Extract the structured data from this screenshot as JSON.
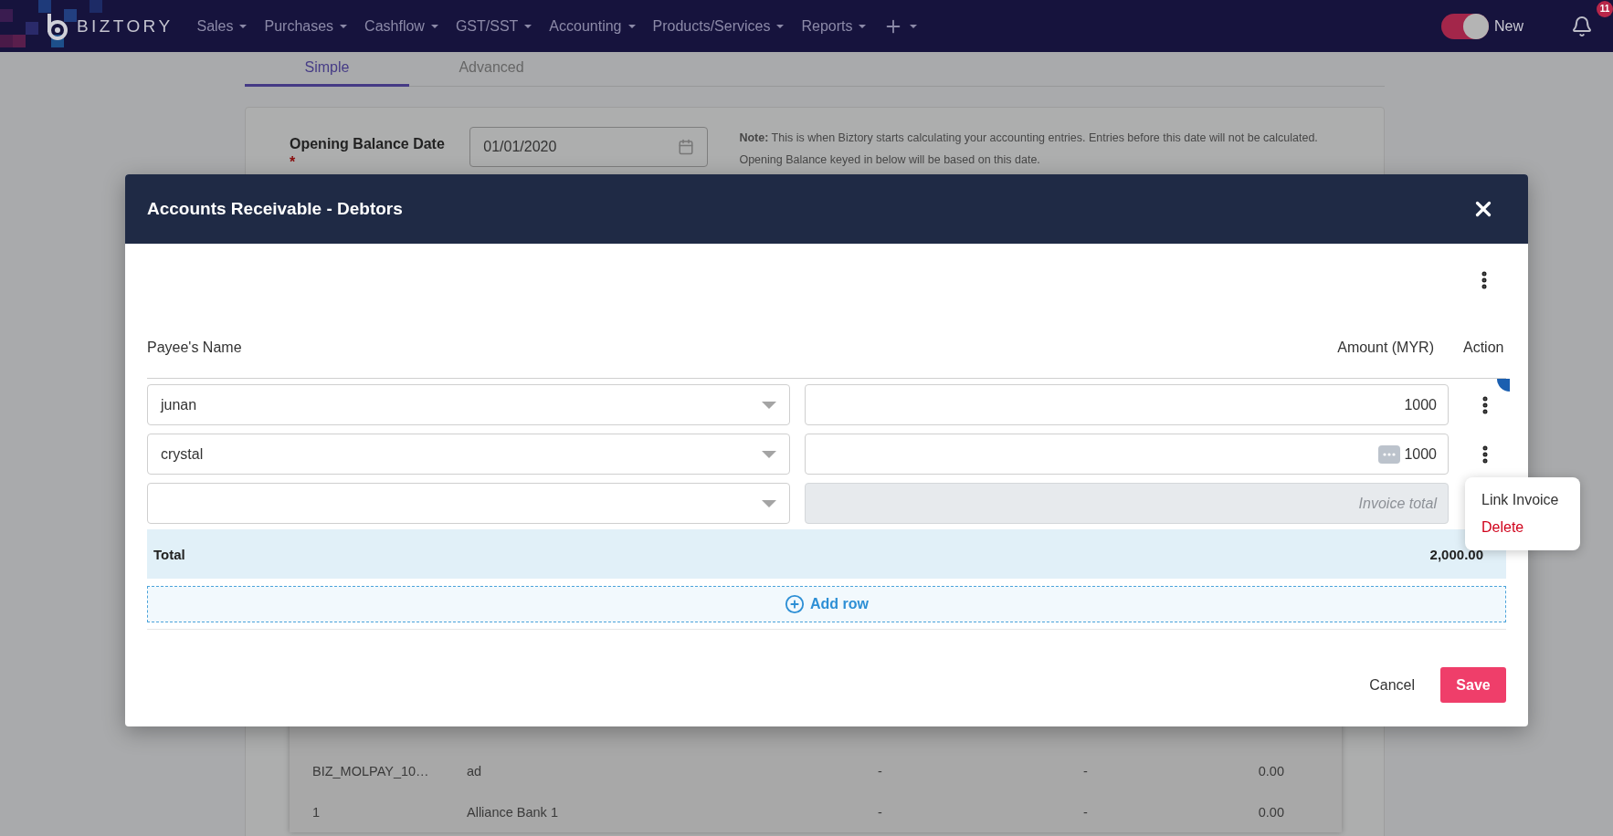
{
  "navbar": {
    "brand": "BIZTORY",
    "menu": [
      "Sales",
      "Purchases",
      "Cashflow",
      "GST/SST",
      "Accounting",
      "Products/Services",
      "Reports"
    ],
    "toggle": {
      "label": "New",
      "on": true
    },
    "notifications": {
      "count": "11"
    }
  },
  "tabs": [
    {
      "label": "Simple",
      "selected": true
    },
    {
      "label": "Advanced",
      "selected": false
    }
  ],
  "opening_balance": {
    "label": "Opening Balance Date",
    "required_mark": "*",
    "value": "01/01/2020",
    "note": "**Note:** This is when Biztory starts calculating your accounting entries. Entries before this date will not be calculated. Opening Balance keyed in below will be based on this date."
  },
  "background_table": {
    "rows": [
      [
        "BIZ_MOLPAY_10…",
        "ad",
        "-",
        "-",
        "0.00"
      ],
      [
        "1",
        "Alliance Bank 1",
        "-",
        "-",
        "0.00"
      ]
    ]
  },
  "dialog": {
    "title": "Accounts Receivable - Debtors",
    "columns": [
      "Payee's Name",
      "Amount (MYR)",
      "Action"
    ],
    "rows": [
      {
        "payee": "junan",
        "amount": "1000",
        "menu_open": false,
        "chip": false,
        "disabled": false
      },
      {
        "payee": "crystal",
        "amount": "1000",
        "menu_open": true,
        "chip": true,
        "disabled": false
      },
      {
        "amount_placeholder": "Invoice total",
        "menu_open": false,
        "chip": false,
        "disabled": true
      }
    ],
    "total_label": "Total",
    "total": "2,000.00",
    "add_row": "Add row",
    "menu": [
      {
        "label": "Link Invoice",
        "kind": "normal"
      },
      {
        "label": "Delete",
        "kind": "danger"
      }
    ],
    "cancel": "Cancel",
    "save": "Save"
  }
}
